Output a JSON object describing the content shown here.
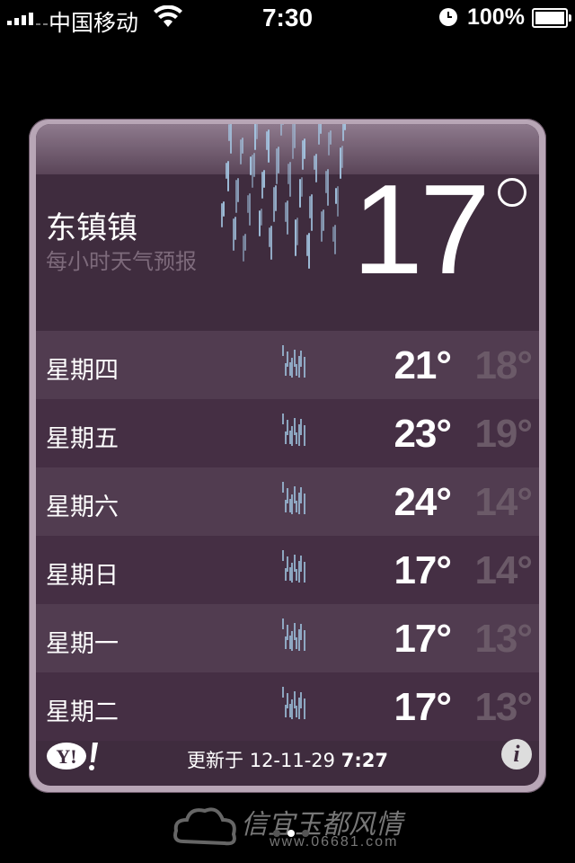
{
  "status_bar": {
    "carrier": "中国移动",
    "time": "7:30",
    "battery_percent": "100%",
    "signal_bars": 4,
    "battery_level": 1.0
  },
  "location": {
    "city": "东镇镇",
    "subtitle": "每小时天气预报",
    "current_temp": "17"
  },
  "forecast": [
    {
      "day": "星期四",
      "high": "21°",
      "low": "18°",
      "icon": "rain-icon"
    },
    {
      "day": "星期五",
      "high": "23°",
      "low": "19°",
      "icon": "rain-icon"
    },
    {
      "day": "星期六",
      "high": "24°",
      "low": "14°",
      "icon": "rain-icon"
    },
    {
      "day": "星期日",
      "high": "17°",
      "low": "14°",
      "icon": "rain-icon"
    },
    {
      "day": "星期一",
      "high": "17°",
      "low": "13°",
      "icon": "rain-icon"
    },
    {
      "day": "星期二",
      "high": "17°",
      "low": "13°",
      "icon": "rain-icon"
    }
  ],
  "footer": {
    "updated_label": "更新于 12-11-29",
    "updated_time": "7:27",
    "yahoo_logo": "Y!",
    "info_icon": "i"
  },
  "watermark": {
    "text": "信宜玉都风情",
    "url": "www.06681.com"
  },
  "colors": {
    "card_bg": "#3f2c3e",
    "row_light": "#513c50",
    "row_dark": "#452f44",
    "low_temp": "#6b5a68"
  }
}
